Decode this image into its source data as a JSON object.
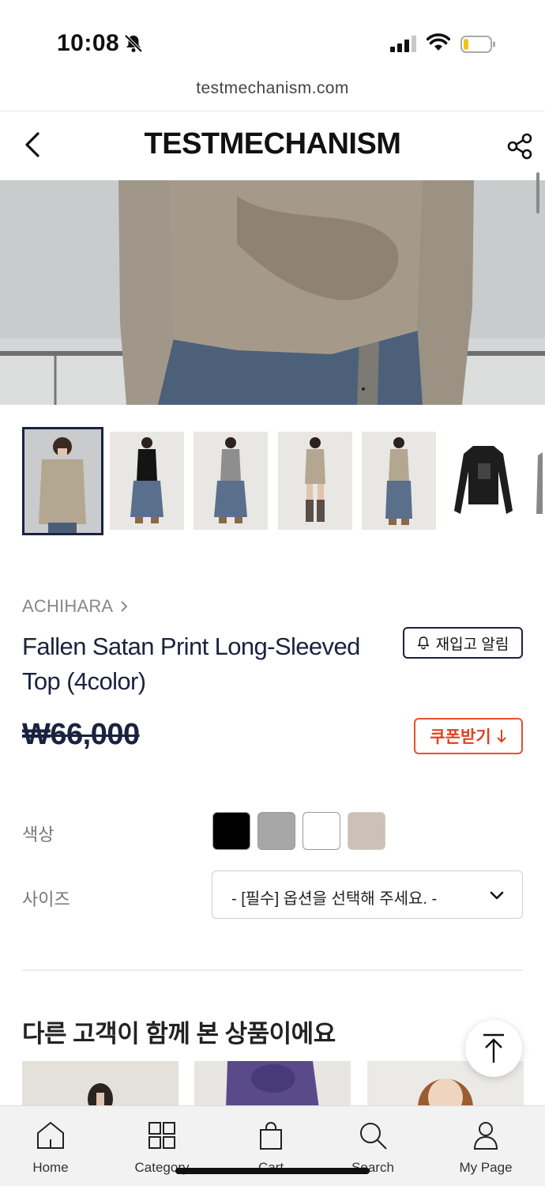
{
  "status_bar": {
    "time": "10:08"
  },
  "url": "testmechanism.com",
  "header": {
    "brand": "TESTMECHANISM"
  },
  "product": {
    "brand_link": "ACHIHARA",
    "title": "Fallen Satan Print Long-Sleeved Top (4color)",
    "price": "₩66,000",
    "restock_label": "재입고 알림",
    "coupon_label": "쿠폰받기"
  },
  "options": {
    "color_label": "색상",
    "size_label": "사이즈",
    "colors": [
      "#000000",
      "#a7a7a7",
      "#ffffff",
      "#cbc1b8"
    ],
    "size_placeholder": "- [필수] 옵션을 선택해 주세요. -"
  },
  "recommend": {
    "title": "다른 고객이 함께 본 상품이에요"
  },
  "nav": {
    "items": [
      {
        "label": "Home",
        "icon": "home-icon"
      },
      {
        "label": "Category",
        "icon": "category-icon"
      },
      {
        "label": "Cart",
        "icon": "cart-icon"
      },
      {
        "label": "Search",
        "icon": "search-icon"
      },
      {
        "label": "My Page",
        "icon": "user-icon"
      }
    ]
  },
  "colors": {
    "navy": "#1b2240",
    "coupon": "#e0431f"
  }
}
